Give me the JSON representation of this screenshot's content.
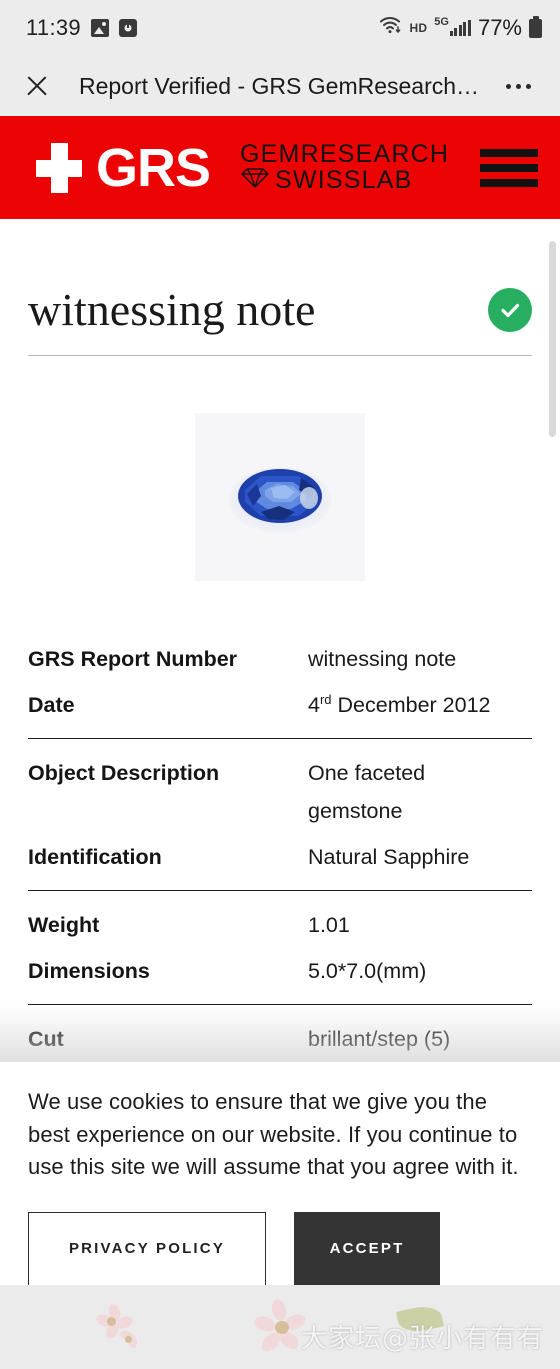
{
  "status_bar": {
    "time": "11:39",
    "left_icons": [
      "gallery-icon",
      "alarm-clock-icon"
    ],
    "wifi_icon": "wifi-icon",
    "hd_label": "HD",
    "network_label": "5G",
    "signal_icon": "signal-bars-icon",
    "battery_percent": "77%",
    "battery_icon": "battery-icon"
  },
  "browser": {
    "close_icon": "close-icon",
    "title": "Report Verified - GRS GemResearch…",
    "more_icon": "more-options-icon"
  },
  "site_header": {
    "brand": "GRS",
    "brand_line1": "GEMRESEARCH",
    "brand_line2": "SWISSLAB",
    "diamond_icon": "diamond-icon",
    "menu_icon": "hamburger-menu-icon",
    "background_color": "#ec0404"
  },
  "document": {
    "title": "witnessing note",
    "verified_icon": "check-circle-icon",
    "verified_color": "#27ae60",
    "gem_image_alt": "blue oval faceted sapphire",
    "groups": [
      {
        "rows": [
          {
            "key": "GRS Report Number",
            "value": "witnessing note"
          },
          {
            "key": "Date",
            "value_prefix": "4",
            "value_sup": "rd",
            "value_suffix": " December 2012"
          }
        ]
      },
      {
        "rows": [
          {
            "key": "Object Description",
            "value": "One faceted gemstone"
          },
          {
            "key": "Identification",
            "value": "Natural Sapphire"
          }
        ]
      },
      {
        "rows": [
          {
            "key": "Weight",
            "value": "1.01"
          },
          {
            "key": "Dimensions",
            "value": "5.0*7.0(mm)"
          }
        ]
      },
      {
        "rows": [
          {
            "key": "Cut",
            "value": "brillant/step  (5)"
          }
        ]
      }
    ]
  },
  "cookie_banner": {
    "message": "We use cookies to ensure that we give you the best experience on our website. If you continue to use this site we will assume that you agree with it.",
    "privacy_label": "PRIVACY POLICY",
    "accept_label": "ACCEPT",
    "accept_color": "#343434"
  },
  "footer": {
    "watermark": "大家坛@张小有有有"
  }
}
